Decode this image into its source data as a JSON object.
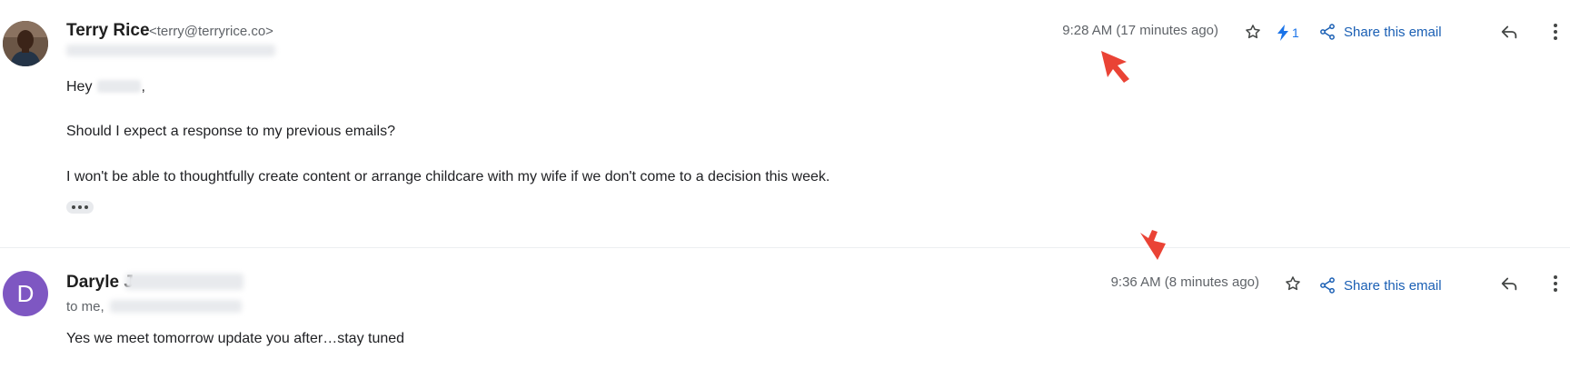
{
  "messages": [
    {
      "sender_name": "Terry Rice",
      "sender_email": "<terry@terryrice.co>",
      "timestamp": "9:28 AM (17 minutes ago)",
      "lightning_count": "1",
      "share_label": "Share this email",
      "greeting_prefix": "Hey",
      "greeting_suffix": ",",
      "paragraphs": [
        "Should I expect a response to my previous emails?",
        "I won't be able to thoughtfully create content or arrange childcare with my wife if we don't come to a decision this week."
      ]
    },
    {
      "avatar_letter": "D",
      "sender_name": "Daryle J",
      "recipients_prefix": "to me,",
      "timestamp": "9:36 AM (8 minutes ago)",
      "share_label": "Share this email",
      "paragraphs": [
        "Yes we meet tomorrow update you after…stay tuned"
      ]
    }
  ],
  "colors": {
    "link_blue": "#1a5fb4",
    "annotation_arrow": "#ea4335",
    "avatar_purple": "#7e57c2"
  },
  "icons": {
    "star": "star-icon",
    "lightning": "lightning-icon",
    "share": "share-icon",
    "reply": "reply-icon",
    "more": "more-vert-icon"
  }
}
